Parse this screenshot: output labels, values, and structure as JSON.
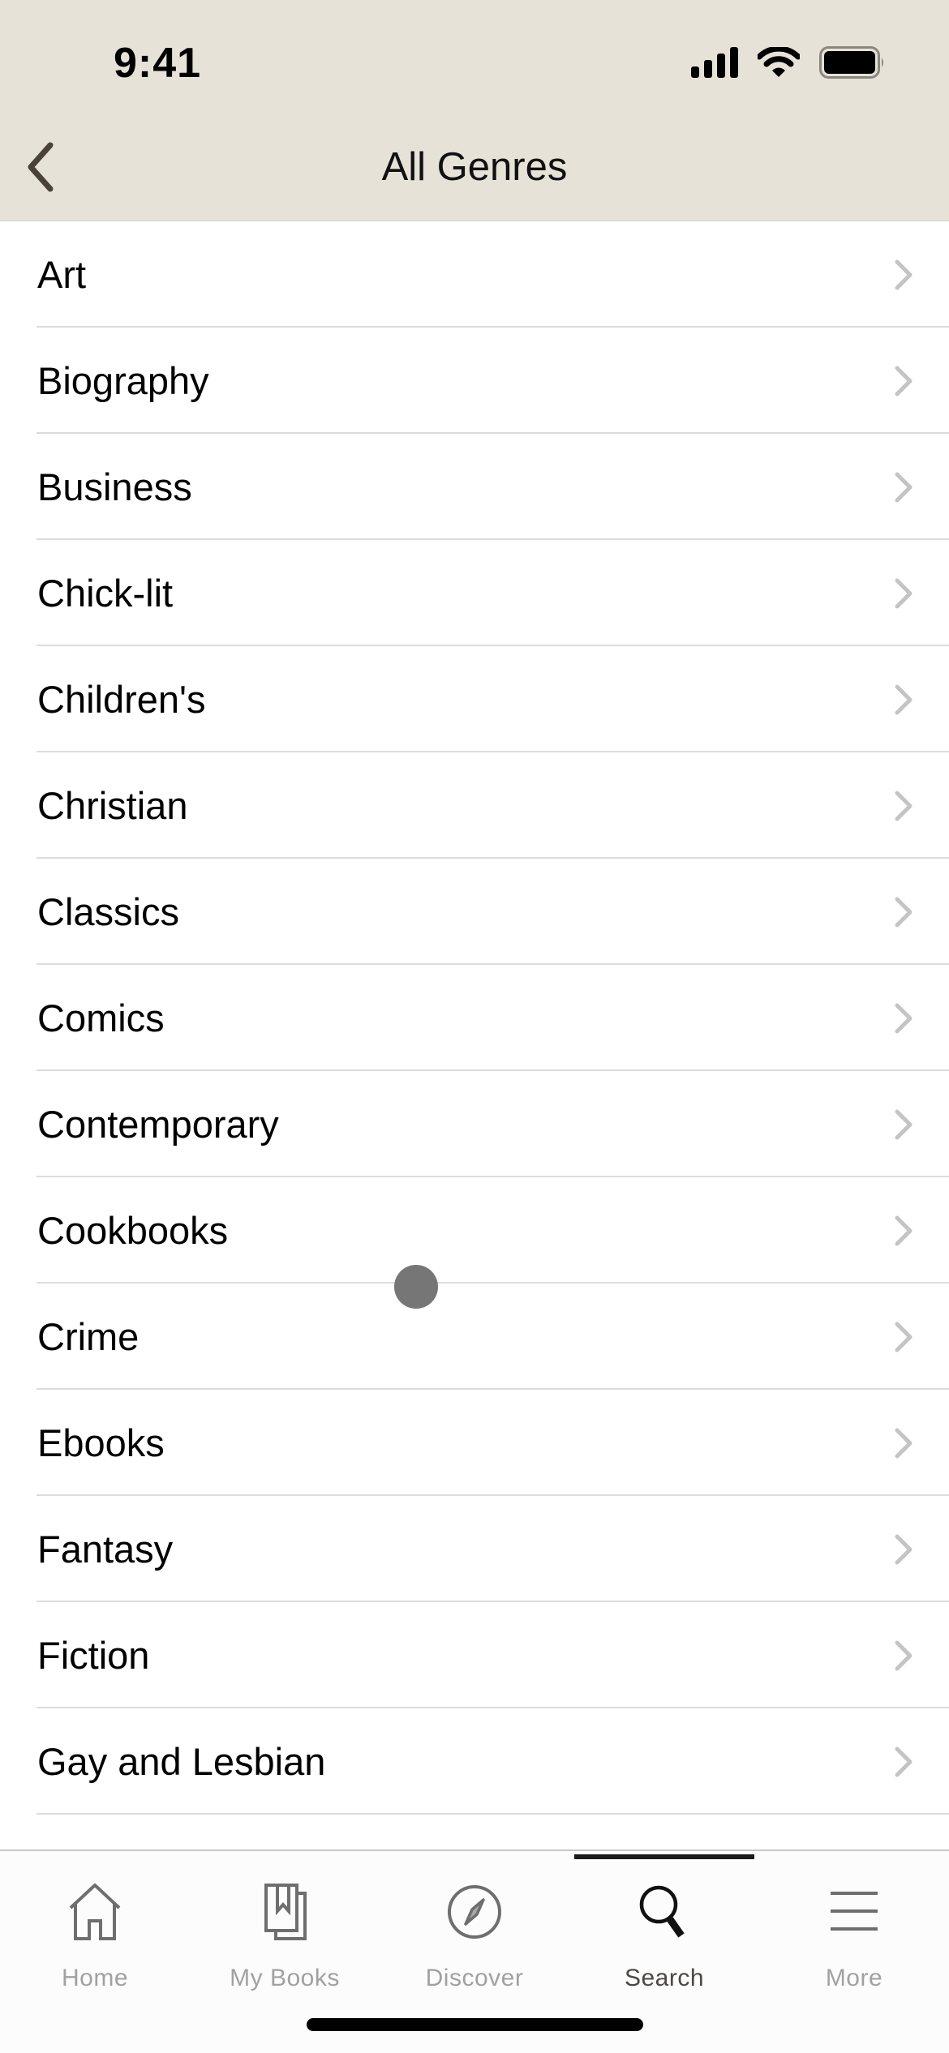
{
  "status_bar": {
    "time": "9:41",
    "icons": [
      "cellular-signal-icon",
      "wifi-icon",
      "battery-icon"
    ]
  },
  "header": {
    "title": "All Genres",
    "back_icon": "chevron-left-icon"
  },
  "genres": [
    {
      "label": "Art"
    },
    {
      "label": "Biography"
    },
    {
      "label": "Business"
    },
    {
      "label": "Chick-lit"
    },
    {
      "label": "Children's"
    },
    {
      "label": "Christian"
    },
    {
      "label": "Classics"
    },
    {
      "label": "Comics"
    },
    {
      "label": "Contemporary"
    },
    {
      "label": "Cookbooks"
    },
    {
      "label": "Crime"
    },
    {
      "label": "Ebooks"
    },
    {
      "label": "Fantasy"
    },
    {
      "label": "Fiction"
    },
    {
      "label": "Gay and Lesbian"
    }
  ],
  "tabbar": {
    "tabs": [
      {
        "label": "Home",
        "icon": "home-icon",
        "active": false
      },
      {
        "label": "My Books",
        "icon": "my-books-icon",
        "active": false
      },
      {
        "label": "Discover",
        "icon": "compass-icon",
        "active": false
      },
      {
        "label": "Search",
        "icon": "search-icon",
        "active": true
      },
      {
        "label": "More",
        "icon": "menu-icon",
        "active": false
      }
    ]
  },
  "colors": {
    "header_bg": "#e6e2d8",
    "back_chevron": "#4a413b",
    "row_chevron": "#c4c4c4",
    "separator": "#dcdcdc",
    "tab_inactive": "#a1a1a1",
    "tab_active": "#4d4745",
    "tab_indicator": "#1a1a1a"
  }
}
